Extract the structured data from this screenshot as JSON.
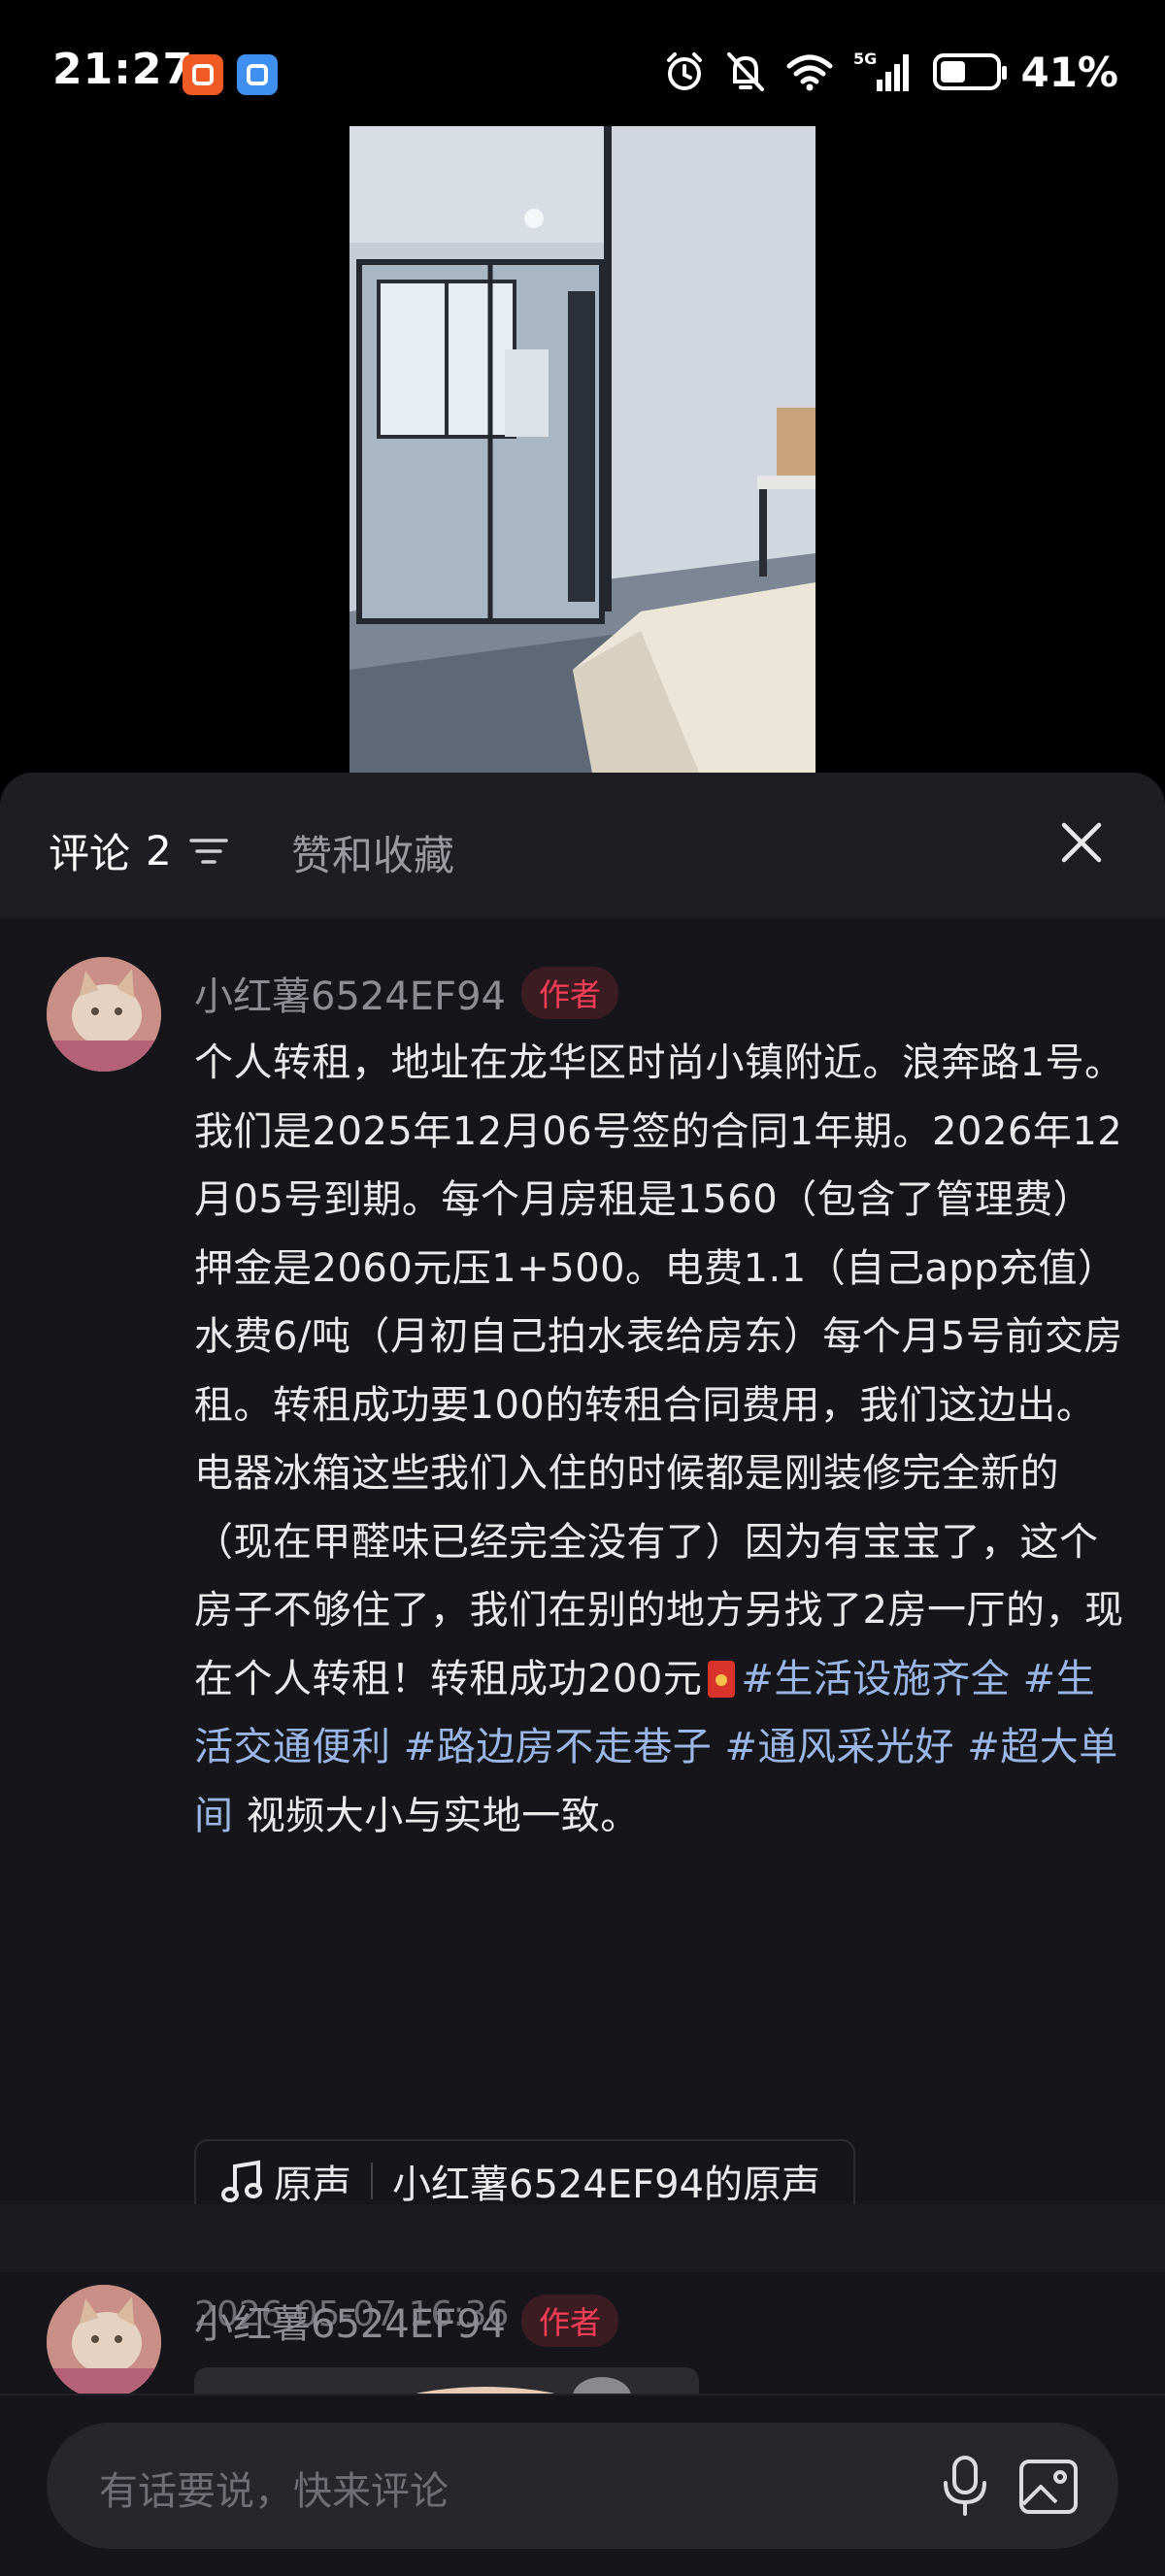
{
  "status_bar": {
    "time": "21:27",
    "battery_text": "41%",
    "battery_level": 0.41,
    "network": "5G",
    "icons": [
      "alarm-icon",
      "mute-icon",
      "wifi-icon",
      "signal-icon",
      "battery-icon"
    ]
  },
  "comments_panel": {
    "tab_comments_label": "评论",
    "comment_count": "2",
    "tab_likes_label": "赞和收藏"
  },
  "comments": [
    {
      "username": "小红薯6524EF94",
      "badge": "作者",
      "body_text": "个人转租，地址在龙华区时尚小镇附近。浪奔路1号。我们是2025年12月06号签的合同1年期。2026年12月05号到期。每个月房租是1560（包含了管理费）押金是2060元压1+500。电费1.1（自己app充值）水费6/吨（月初自己拍水表给房东）每个月5号前交房租。转租成功要100的转租合同费用，我们这边出。电器冰箱这些我们入住的时候都是刚装修完全新的（现在甲醛味已经完全没有了）因为有宝宝了，这个房子不够住了，我们在别的地方另找了2房一厅的，现在个人转租！转租成功200元",
      "tags": [
        "#生活设施齐全",
        "#生活交通便利",
        "#路边房不走巷子",
        "#通风采光好",
        "#超大单间"
      ],
      "tail_text": " 视频大小与实地一致。",
      "sound_label": "原声",
      "sound_name": "小红薯6524EF94的原声",
      "timestamp": "2026-05-07 16:36"
    },
    {
      "username": "小红薯6524EF94",
      "badge": "作者"
    }
  ],
  "input_bar": {
    "placeholder": "有话要说，快来评论"
  },
  "colors": {
    "sheet_bg": "#16161a",
    "header_bg": "#1e1e22",
    "tag_blue": "#9ab6e6",
    "author_red": "#ff3d57"
  }
}
